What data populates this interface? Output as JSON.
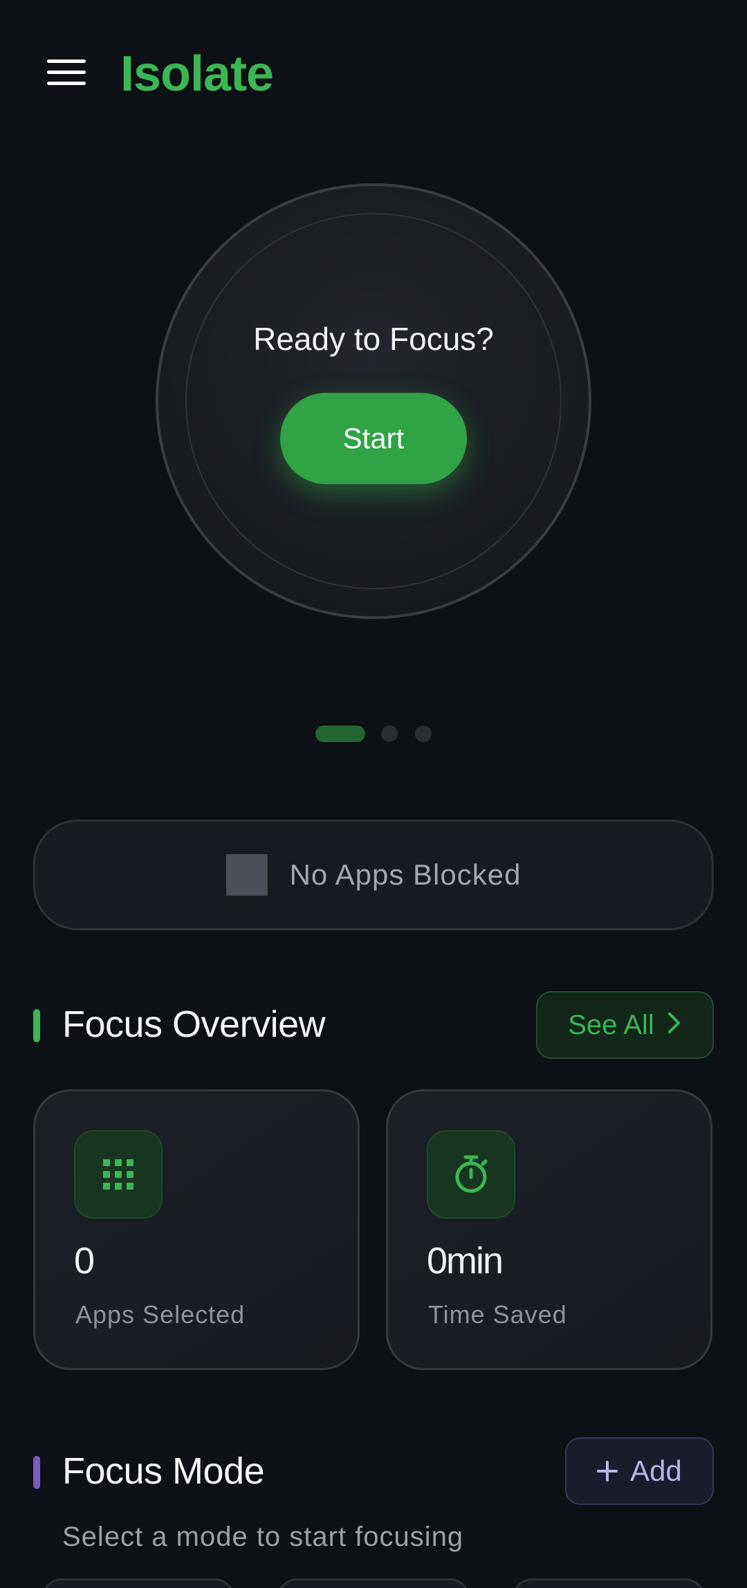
{
  "app": {
    "title": "Isolate",
    "accent_color": "#3cb654"
  },
  "header": {
    "menu_icon": "hamburger-menu-icon"
  },
  "focus": {
    "question": "Ready to Focus?",
    "start_label": "Start",
    "pager": {
      "count": 3,
      "active_index": 0
    }
  },
  "blocked": {
    "label": "No Apps Blocked",
    "icon": "app-placeholder-icon"
  },
  "overview": {
    "title": "Focus Overview",
    "see_all_label": "See All",
    "accent_color": "#3cb654",
    "cards": [
      {
        "value": "0",
        "label": "Apps Selected",
        "icon": "apps-grid-icon"
      },
      {
        "value": "0min",
        "label": "Time Saved",
        "icon": "stopwatch-icon"
      }
    ]
  },
  "focus_mode": {
    "title": "Focus Mode",
    "add_label": "Add",
    "subtitle": "Select a mode to start focusing",
    "accent_color": "#7b5cc4"
  }
}
